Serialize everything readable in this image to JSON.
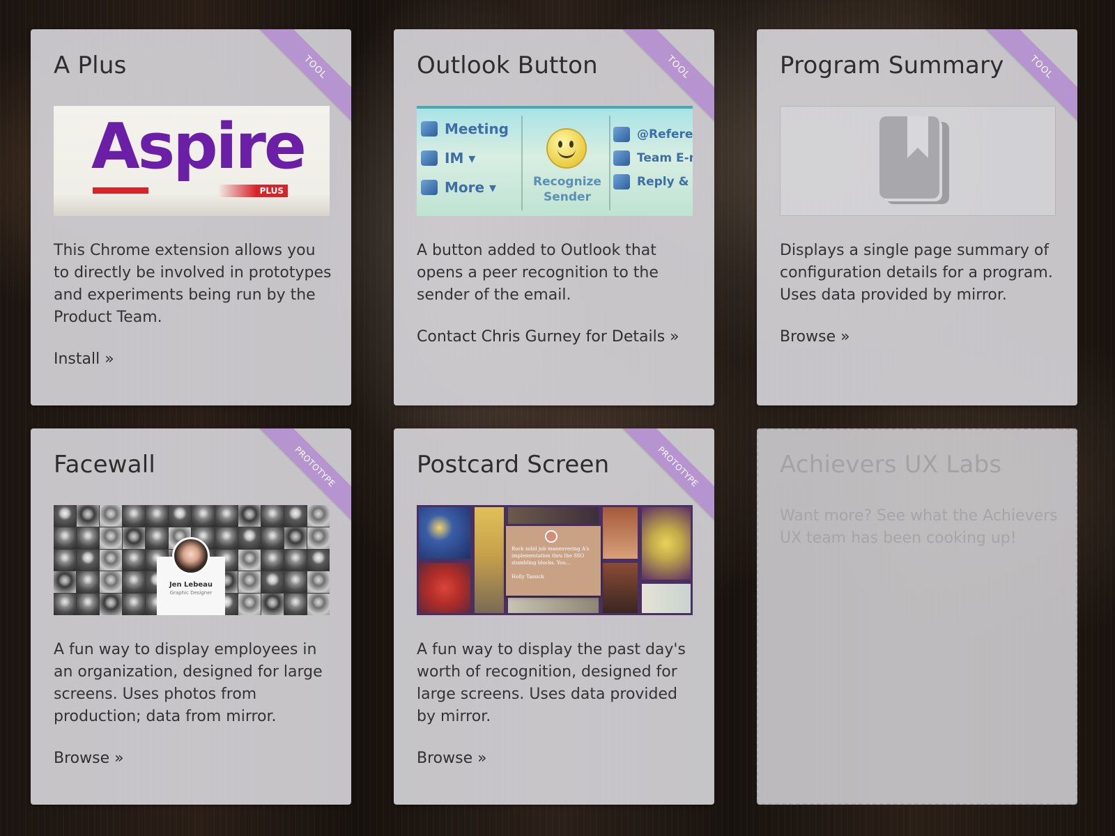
{
  "cards": [
    {
      "title": "A Plus",
      "ribbon": "TOOL",
      "image": {
        "logo_text": "Aspire",
        "logo_badge": "PLUS"
      },
      "description": "This Chrome extension allows you to directly be involved in prototypes and experiments being run by the Product Team.",
      "link": "Install »"
    },
    {
      "title": "Outlook Button",
      "ribbon": "TOOL",
      "image": {
        "items_left": [
          "Meeting",
          "IM ▾",
          "More ▾"
        ],
        "center_label": "Recognize Sender",
        "items_right": [
          "@Referen",
          "Team E-ma",
          "Reply & D"
        ]
      },
      "description": "A button added to Outlook that opens a peer recognition to the sender of the email.",
      "link": "Contact Chris Gurney for Details »"
    },
    {
      "title": "Program Summary",
      "ribbon": "TOOL",
      "image": {
        "icon": "book-icon"
      },
      "description": "Displays a single page summary of configuration details for a program. Uses data provided by mirror.",
      "link": "Browse »"
    },
    {
      "title": "Facewall",
      "ribbon": "PROTOTYPE",
      "image": {
        "person_name": "Jen Lebeau",
        "person_role": "Graphic Designer"
      },
      "description": "A fun way to display employees in an organization, designed for large screens. Uses photos from production; data from mirror.",
      "link": "Browse »"
    },
    {
      "title": "Postcard Screen",
      "ribbon": "PROTOTYPE",
      "image": {
        "note_text": "Rock solid job maneuvering A's implementation thru the SSO stumbling blocks. You...",
        "note_signature": "Holly Tassick"
      },
      "description": "A fun way to display the past day's worth of recognition, designed for large screens. Uses data provided by mirror.",
      "link": "Browse »"
    },
    {
      "title": "Achievers UX Labs",
      "description": "Want more? See what the Achievers UX team has been cooking up!"
    }
  ],
  "colors": {
    "ribbon": "#b594cf",
    "card_background": "#d8d7db",
    "aspire_purple": "#6a1fa6",
    "aspire_red": "#d8232a"
  }
}
